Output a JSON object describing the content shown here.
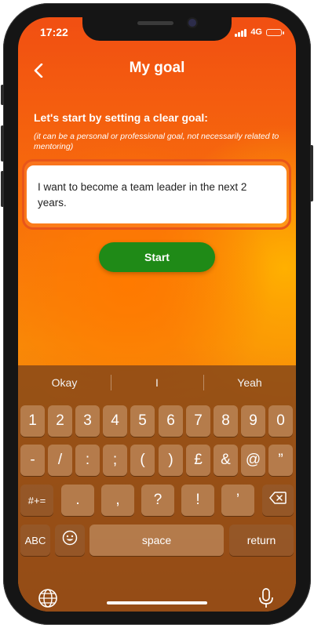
{
  "status": {
    "time": "17:22",
    "network": "4G"
  },
  "header": {
    "title": "My goal"
  },
  "content": {
    "prompt": "Let's start by setting a clear goal:",
    "hint": "(it can be a personal or professional goal, not necessarily related to mentoring)",
    "goal_text": "I want to become a team leader in the next 2 years.",
    "start_label": "Start"
  },
  "keyboard": {
    "suggestions": [
      "Okay",
      "I",
      "Yeah"
    ],
    "row1": [
      "1",
      "2",
      "3",
      "4",
      "5",
      "6",
      "7",
      "8",
      "9",
      "0"
    ],
    "row2": [
      "-",
      "/",
      ":",
      ";",
      "(",
      ")",
      "£",
      "&",
      "@",
      "”"
    ],
    "row3": [
      ".",
      ",",
      "?",
      "!",
      "’"
    ],
    "symbols_label": "#+=",
    "abc_label": "ABC",
    "space_label": "space",
    "return_label": "return"
  }
}
